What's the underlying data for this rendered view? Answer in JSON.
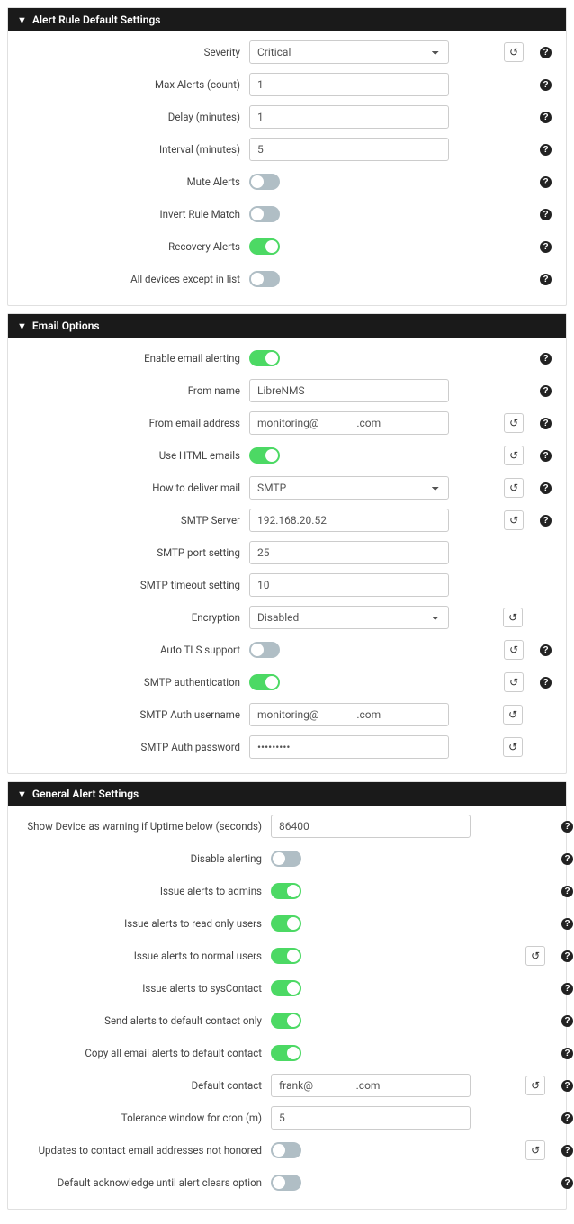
{
  "panels": {
    "alertRules": {
      "title": "Alert Rule Default Settings",
      "rows": [
        {
          "key": "severity",
          "label": "Severity",
          "type": "select",
          "value": "Critical",
          "reset": true,
          "help": true
        },
        {
          "key": "maxAlerts",
          "label": "Max Alerts (count)",
          "type": "text",
          "value": "1",
          "reset": false,
          "help": true
        },
        {
          "key": "delay",
          "label": "Delay (minutes)",
          "type": "text",
          "value": "1",
          "reset": false,
          "help": true
        },
        {
          "key": "interval",
          "label": "Interval (minutes)",
          "type": "text",
          "value": "5",
          "reset": false,
          "help": true
        },
        {
          "key": "mute",
          "label": "Mute Alerts",
          "type": "toggle",
          "value": "off",
          "reset": false,
          "help": true
        },
        {
          "key": "invert",
          "label": "Invert Rule Match",
          "type": "toggle",
          "value": "off",
          "reset": false,
          "help": true
        },
        {
          "key": "recovery",
          "label": "Recovery Alerts",
          "type": "toggle",
          "value": "on",
          "reset": false,
          "help": true
        },
        {
          "key": "allExcept",
          "label": "All devices except in list",
          "type": "toggle",
          "value": "off",
          "reset": false,
          "help": true
        }
      ]
    },
    "emailOptions": {
      "title": "Email Options",
      "rows": [
        {
          "key": "enable",
          "label": "Enable email alerting",
          "type": "toggle",
          "value": "on",
          "reset": false,
          "help": true
        },
        {
          "key": "fromName",
          "label": "From name",
          "type": "text",
          "value": "LibreNMS",
          "reset": false,
          "help": true
        },
        {
          "key": "fromEmail",
          "label": "From email address",
          "type": "text",
          "value": "monitoring@              .com",
          "reset": true,
          "help": true
        },
        {
          "key": "htmlEmails",
          "label": "Use HTML emails",
          "type": "toggle",
          "value": "on",
          "reset": true,
          "help": true
        },
        {
          "key": "deliver",
          "label": "How to deliver mail",
          "type": "select",
          "value": "SMTP",
          "reset": true,
          "help": true
        },
        {
          "key": "smtpServer",
          "label": "SMTP Server",
          "type": "text",
          "value": "192.168.20.52",
          "reset": true,
          "help": true
        },
        {
          "key": "smtpPort",
          "label": "SMTP port setting",
          "type": "text",
          "value": "25",
          "reset": false,
          "help": false
        },
        {
          "key": "smtpTimeout",
          "label": "SMTP timeout setting",
          "type": "text",
          "value": "10",
          "reset": false,
          "help": false
        },
        {
          "key": "encryption",
          "label": "Encryption",
          "type": "select",
          "value": "Disabled",
          "reset": true,
          "help": false
        },
        {
          "key": "autoTls",
          "label": "Auto TLS support",
          "type": "toggle",
          "value": "off",
          "reset": true,
          "help": true
        },
        {
          "key": "smtpAuth",
          "label": "SMTP authentication",
          "type": "toggle",
          "value": "on",
          "reset": true,
          "help": true
        },
        {
          "key": "authUser",
          "label": "SMTP Auth username",
          "type": "text",
          "value": "monitoring@              .com",
          "reset": true,
          "help": false
        },
        {
          "key": "authPass",
          "label": "SMTP Auth password",
          "type": "password",
          "value": "•••••••••",
          "reset": true,
          "help": false
        }
      ]
    },
    "generalAlert": {
      "title": "General Alert Settings",
      "labelWidth": "47%",
      "rows": [
        {
          "key": "uptime",
          "label": "Show Device as warning if Uptime below (seconds)",
          "type": "text",
          "value": "86400",
          "reset": false,
          "help": true
        },
        {
          "key": "disable",
          "label": "Disable alerting",
          "type": "toggle",
          "value": "off",
          "reset": false,
          "help": true
        },
        {
          "key": "admins",
          "label": "Issue alerts to admins",
          "type": "toggle",
          "value": "on",
          "reset": false,
          "help": true
        },
        {
          "key": "readonly",
          "label": "Issue alerts to read only users",
          "type": "toggle",
          "value": "on",
          "reset": false,
          "help": true
        },
        {
          "key": "normal",
          "label": "Issue alerts to normal users",
          "type": "toggle",
          "value": "on",
          "reset": true,
          "help": true
        },
        {
          "key": "syscontact",
          "label": "Issue alerts to sysContact",
          "type": "toggle",
          "value": "on",
          "reset": false,
          "help": true
        },
        {
          "key": "defaultonly",
          "label": "Send alerts to default contact only",
          "type": "toggle",
          "value": "on",
          "reset": false,
          "help": true
        },
        {
          "key": "copyall",
          "label": "Copy all email alerts to default contact",
          "type": "toggle",
          "value": "on",
          "reset": false,
          "help": true
        },
        {
          "key": "defaultcontact",
          "label": "Default contact",
          "type": "text",
          "value": "frank@                .com",
          "reset": true,
          "help": true
        },
        {
          "key": "tolerance",
          "label": "Tolerance window for cron (m)",
          "type": "text",
          "value": "5",
          "reset": false,
          "help": true
        },
        {
          "key": "updates",
          "label": "Updates to contact email addresses not honored",
          "type": "toggle",
          "value": "off",
          "reset": true,
          "help": true
        },
        {
          "key": "ackdefault",
          "label": "Default acknowledge until alert clears option",
          "type": "toggle",
          "value": "off",
          "reset": false,
          "help": true
        }
      ]
    }
  }
}
